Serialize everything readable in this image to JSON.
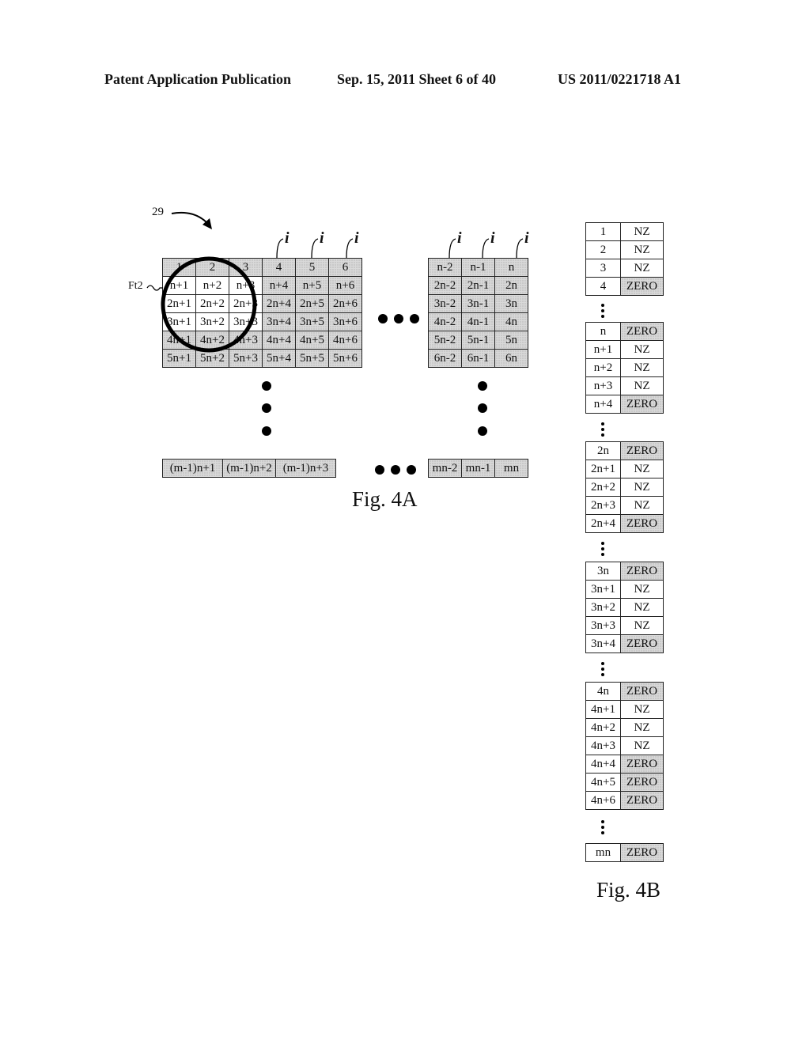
{
  "header": {
    "left": "Patent Application Publication",
    "middle": "Sep. 15, 2011   Sheet 6 of 40",
    "right": "US 2011/0221718 A1"
  },
  "fig4a": {
    "label": "Fig. 4A",
    "reference": "29",
    "filter_label": "Ft2",
    "index_marker": "i",
    "left_block": {
      "rows": [
        [
          "1",
          "2",
          "3",
          "4",
          "5",
          "6"
        ],
        [
          "n+1",
          "n+2",
          "n+3",
          "n+4",
          "n+5",
          "n+6"
        ],
        [
          "2n+1",
          "2n+2",
          "2n+3",
          "2n+4",
          "2n+5",
          "2n+6"
        ],
        [
          "3n+1",
          "3n+2",
          "3n+3",
          "3n+4",
          "3n+5",
          "3n+6"
        ],
        [
          "4n+1",
          "4n+2",
          "4n+3",
          "4n+4",
          "4n+5",
          "4n+6"
        ],
        [
          "5n+1",
          "5n+2",
          "5n+3",
          "5n+4",
          "5n+5",
          "5n+6"
        ]
      ],
      "unshaded_cells": [
        [
          1,
          0
        ],
        [
          1,
          1
        ],
        [
          1,
          2
        ],
        [
          2,
          0
        ],
        [
          2,
          1
        ],
        [
          2,
          2
        ],
        [
          3,
          0
        ],
        [
          3,
          1
        ],
        [
          3,
          2
        ]
      ]
    },
    "right_block": {
      "rows": [
        [
          "n-2",
          "n-1",
          "n"
        ],
        [
          "2n-2",
          "2n-1",
          "2n"
        ],
        [
          "3n-2",
          "3n-1",
          "3n"
        ],
        [
          "4n-2",
          "4n-1",
          "4n"
        ],
        [
          "5n-2",
          "5n-1",
          "5n"
        ],
        [
          "6n-2",
          "6n-1",
          "6n"
        ]
      ]
    },
    "bottom_left": [
      "(m-1)n+1",
      "(m-1)n+2",
      "(m-1)n+3"
    ],
    "bottom_right": [
      "mn-2",
      "mn-1",
      "mn"
    ]
  },
  "fig4b": {
    "label": "Fig. 4B",
    "groups": [
      [
        [
          "1",
          "NZ"
        ],
        [
          "2",
          "NZ"
        ],
        [
          "3",
          "NZ"
        ],
        [
          "4",
          "ZERO"
        ]
      ],
      [
        [
          "n",
          "ZERO"
        ],
        [
          "n+1",
          "NZ"
        ],
        [
          "n+2",
          "NZ"
        ],
        [
          "n+3",
          "NZ"
        ],
        [
          "n+4",
          "ZERO"
        ]
      ],
      [
        [
          "2n",
          "ZERO"
        ],
        [
          "2n+1",
          "NZ"
        ],
        [
          "2n+2",
          "NZ"
        ],
        [
          "2n+3",
          "NZ"
        ],
        [
          "2n+4",
          "ZERO"
        ]
      ],
      [
        [
          "3n",
          "ZERO"
        ],
        [
          "3n+1",
          "NZ"
        ],
        [
          "3n+2",
          "NZ"
        ],
        [
          "3n+3",
          "NZ"
        ],
        [
          "3n+4",
          "ZERO"
        ]
      ],
      [
        [
          "4n",
          "ZERO"
        ],
        [
          "4n+1",
          "NZ"
        ],
        [
          "4n+2",
          "NZ"
        ],
        [
          "4n+3",
          "NZ"
        ],
        [
          "4n+4",
          "ZERO"
        ],
        [
          "4n+5",
          "ZERO"
        ],
        [
          "4n+6",
          "ZERO"
        ]
      ],
      [
        [
          "mn",
          "ZERO"
        ]
      ]
    ]
  }
}
